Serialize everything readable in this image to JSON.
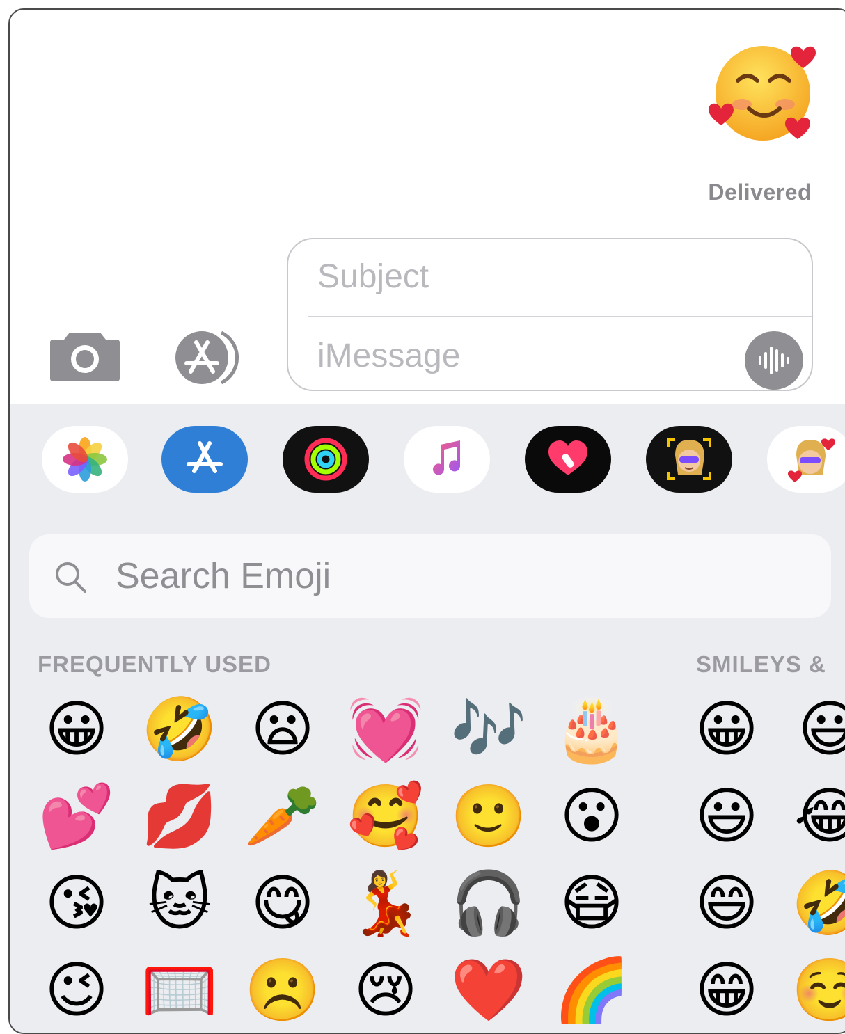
{
  "conversation": {
    "sent_emoji": "🥰",
    "status": "Delivered"
  },
  "compose": {
    "subject_placeholder": "Subject",
    "message_placeholder": "iMessage"
  },
  "toolbar": {
    "camera_icon": "camera-icon",
    "apps_icon": "app-store-icon",
    "audio_icon": "audio-waveform-icon"
  },
  "app_strip": [
    {
      "name": "photos",
      "icon": "photos-icon",
      "bg": "#ffffff"
    },
    {
      "name": "app-store",
      "icon": "app-store-icon",
      "bg": "#2f7fd6"
    },
    {
      "name": "activity",
      "icon": "activity-rings-icon",
      "bg": "#111111"
    },
    {
      "name": "music",
      "icon": "music-note-icon",
      "bg": "#ffffff"
    },
    {
      "name": "digital-touch",
      "icon": "heart-touch-icon",
      "bg": "#0a0a0a"
    },
    {
      "name": "memoji",
      "icon": "memoji-face-icon",
      "bg": "#111111"
    },
    {
      "name": "memoji-stickers",
      "icon": "memoji-sticker-icon",
      "bg": "#ffffff"
    }
  ],
  "search": {
    "placeholder": "Search Emoji"
  },
  "sections": {
    "frequently_used": "FREQUENTLY USED",
    "smileys": "SMILEYS &"
  },
  "frequently_used": [
    [
      "😀",
      "🤣",
      "😦",
      "💓",
      "🎶",
      "🎂"
    ],
    [
      "💕",
      "💋",
      "🥕",
      "🥰",
      "🙂",
      "😮"
    ],
    [
      "😘",
      "🐱",
      "😋",
      "💃",
      "🎧",
      "😷"
    ],
    [
      "😉",
      "🥅",
      "☹️",
      "😢",
      "❤️",
      "🌈"
    ]
  ],
  "smileys": [
    [
      "😀",
      "😃"
    ],
    [
      "😃",
      "😂"
    ],
    [
      "😄",
      "🤣"
    ],
    [
      "😁",
      "☺️"
    ]
  ]
}
